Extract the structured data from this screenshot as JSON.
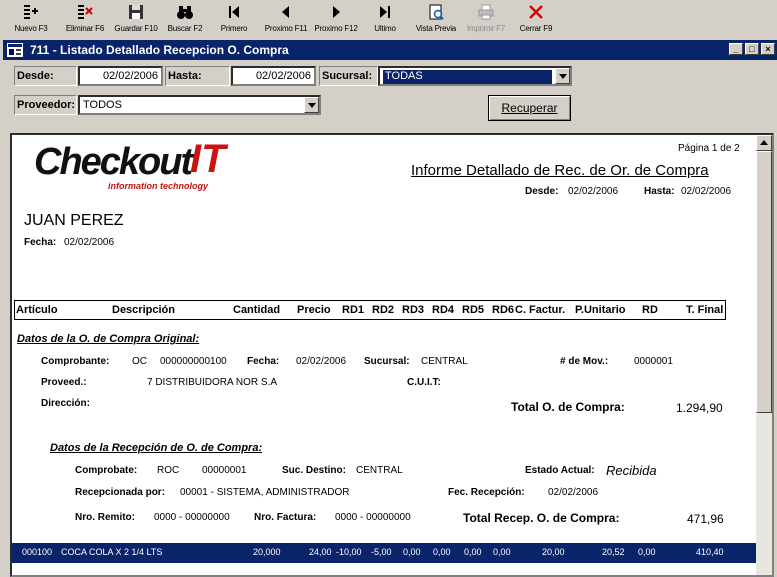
{
  "toolbar": {
    "buttons": [
      {
        "label": "Nuevo F3",
        "icon": "new-icon",
        "enabled": true
      },
      {
        "label": "Eliminar F6",
        "icon": "delete-icon",
        "enabled": true
      },
      {
        "label": "Guardar F10",
        "icon": "save-icon",
        "enabled": true
      },
      {
        "label": "Buscar F2",
        "icon": "binoculars-icon",
        "enabled": true
      },
      {
        "label": "Primero",
        "icon": "first-icon",
        "enabled": true
      },
      {
        "label": "Proximo F11",
        "icon": "previous-icon",
        "enabled": true
      },
      {
        "label": "Proximo F12",
        "icon": "next-icon",
        "enabled": true
      },
      {
        "label": "Ultimo",
        "icon": "last-icon",
        "enabled": true
      },
      {
        "label": "Vista Previa",
        "icon": "preview-icon",
        "enabled": true
      },
      {
        "label": "Imprimir F7",
        "icon": "print-icon",
        "enabled": false
      },
      {
        "label": "Cerrar F9",
        "icon": "close-x-icon",
        "enabled": true
      }
    ]
  },
  "window": {
    "title": "711 - Listado Detallado Recepcion O. Compra",
    "minimize": "_",
    "maximize": "□",
    "close": "×"
  },
  "filters": {
    "desde_label": "Desde:",
    "desde_value": "02/02/2006",
    "hasta_label": "Hasta:",
    "hasta_value": "02/02/2006",
    "sucursal_label": "Sucursal:",
    "sucursal_value": "TODAS",
    "proveedor_label": "Proveedor:",
    "proveedor_value": "TODOS",
    "recuperar_button": "Recuperar"
  },
  "report": {
    "logo_main": "Checkout",
    "logo_it": "IT",
    "logo_tagline": "information technology",
    "page_info": "Página 1 de 2",
    "title": "Informe Detallado de Rec. de Or. de Compra",
    "desde_label": "Desde:",
    "desde_value": "02/02/2006",
    "hasta_label": "Hasta:",
    "hasta_value": "02/02/2006",
    "user_name": "JUAN PEREZ",
    "fecha_label": "Fecha:",
    "fecha_value": "02/02/2006",
    "columns": [
      "Artículo",
      "Descripción",
      "Cantidad",
      "Precio",
      "RD1",
      "RD2",
      "RD3",
      "RD4",
      "RD5",
      "RD6",
      "C. Factur.",
      "P.Unitario",
      "RD",
      "T. Final"
    ],
    "oc_section": {
      "heading": "Datos de la O. de Compra Original:",
      "comprobante_label": "Comprobante:",
      "comprobante_tipo": "OC",
      "comprobante_num": "000000000100",
      "fecha_label": "Fecha:",
      "fecha_value": "02/02/2006",
      "sucursal_label": "Sucursal:",
      "sucursal_value": "CENTRAL",
      "mov_label": "# de Mov.:",
      "mov_value": "0000001",
      "proveed_label": "Proveed.:",
      "proveed_value": "7  DISTRIBUIDORA NOR S.A",
      "cuit_label": "C.U.I.T:",
      "direccion_label": "Dirección:",
      "total_label": "Total O. de Compra:",
      "total_value": "1.294,90"
    },
    "rec_section": {
      "heading": "Datos de la Recepción de O. de Compra:",
      "comprobate_label": "Comprobate:",
      "comprobate_tipo": "ROC",
      "comprobate_num": "00000001",
      "suc_destino_label": "Suc. Destino:",
      "suc_destino_value": "CENTRAL",
      "estado_label": "Estado Actual:",
      "estado_value": "Recibida",
      "recepcionada_label": "Recepcionada por:",
      "recepcionada_value": "00001 - SISTEMA, ADMINISTRADOR",
      "fec_recepcion_label": "Fec. Recepción:",
      "fec_recepcion_value": "02/02/2006",
      "remito_label": "Nro. Remito:",
      "remito_value": "0000 - 00000000",
      "factura_label": "Nro. Factura:",
      "factura_value": "0000 - 00000000",
      "total_label": "Total Recep. O. de Compra:",
      "total_value": "471,96"
    },
    "row": {
      "articulo": "000100",
      "descripcion": "COCA COLA X 2 1/4 LTS",
      "cantidad": "20,000",
      "precio": "24,00",
      "rd1": "-10,00",
      "rd2": "-5,00",
      "rd3": "0,00",
      "rd4": "0,00",
      "rd5": "0,00",
      "rd6": "0,00",
      "c_factur": "20,00",
      "p_unitario": "20,52",
      "rd": "0,00",
      "t_final": "410,40"
    }
  },
  "colors": {
    "titlebar": "#0a246a",
    "face": "#d4d0c8",
    "logo_red": "#cc1111",
    "row_highlight": "#0a246a"
  }
}
